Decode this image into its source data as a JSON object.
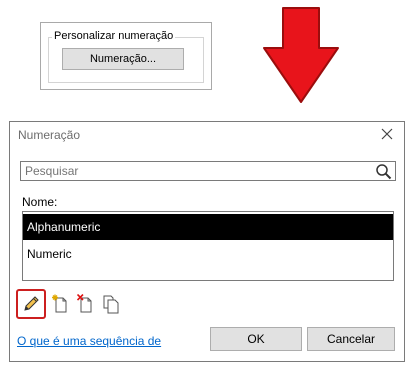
{
  "group": {
    "legend": "Personalizar numeração",
    "button_label": "Numeração..."
  },
  "dialog": {
    "title": "Numeração",
    "search": {
      "placeholder": "Pesquisar",
      "value": ""
    },
    "name_label": "Nome:",
    "items": [
      {
        "label": "Alphanumeric",
        "selected": true
      },
      {
        "label": "Numeric",
        "selected": false
      }
    ],
    "help_link": "O que é uma sequência de",
    "ok_label": "OK",
    "cancel_label": "Cancelar"
  },
  "colors": {
    "arrow_fill": "#e8141b",
    "highlight_border": "#cc1f1f",
    "selection_bg": "#000000",
    "link": "#0066cc"
  },
  "icons": [
    "pencil-icon",
    "new-item-icon",
    "delete-item-icon",
    "copy-icon",
    "search-icon",
    "close-icon",
    "down-arrow-icon"
  ]
}
